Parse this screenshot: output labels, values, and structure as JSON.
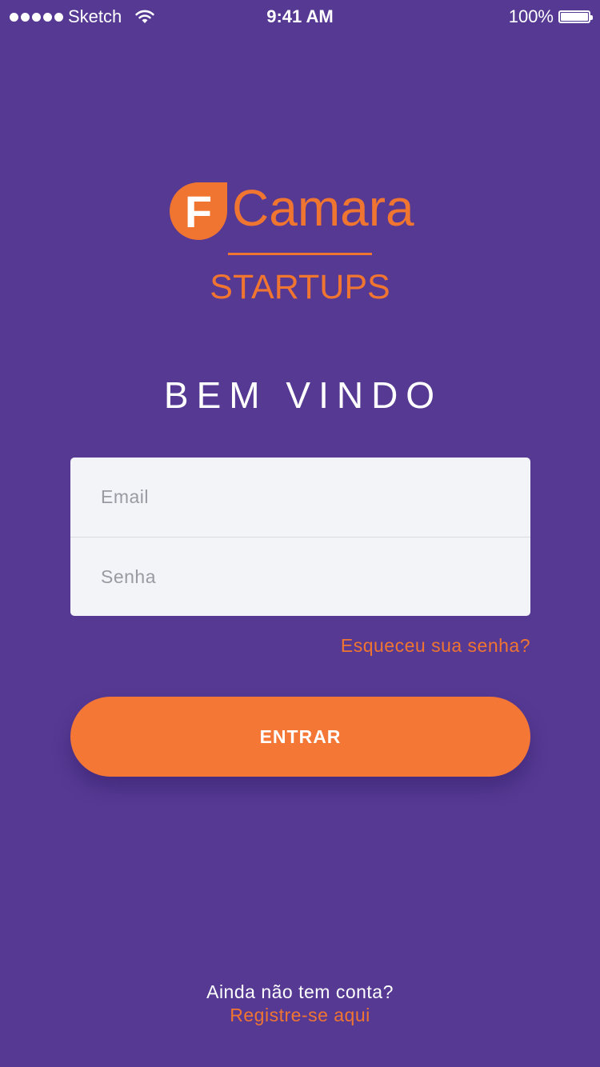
{
  "status_bar": {
    "carrier": "Sketch",
    "time": "9:41 AM",
    "battery": "100%"
  },
  "logo": {
    "letter": "F",
    "name": "Camara",
    "subtitle": "STARTUPS"
  },
  "welcome": "BEM VINDO",
  "form": {
    "email_placeholder": "Email",
    "password_placeholder": "Senha",
    "forgot_password": "Esqueceu sua senha?",
    "submit_label": "ENTRAR"
  },
  "footer": {
    "question": "Ainda não tem conta?",
    "register_link": "Registre-se aqui"
  },
  "colors": {
    "background": "#553993",
    "accent": "#F07530",
    "button": "#F47736",
    "input_background": "#F3F4F7"
  }
}
